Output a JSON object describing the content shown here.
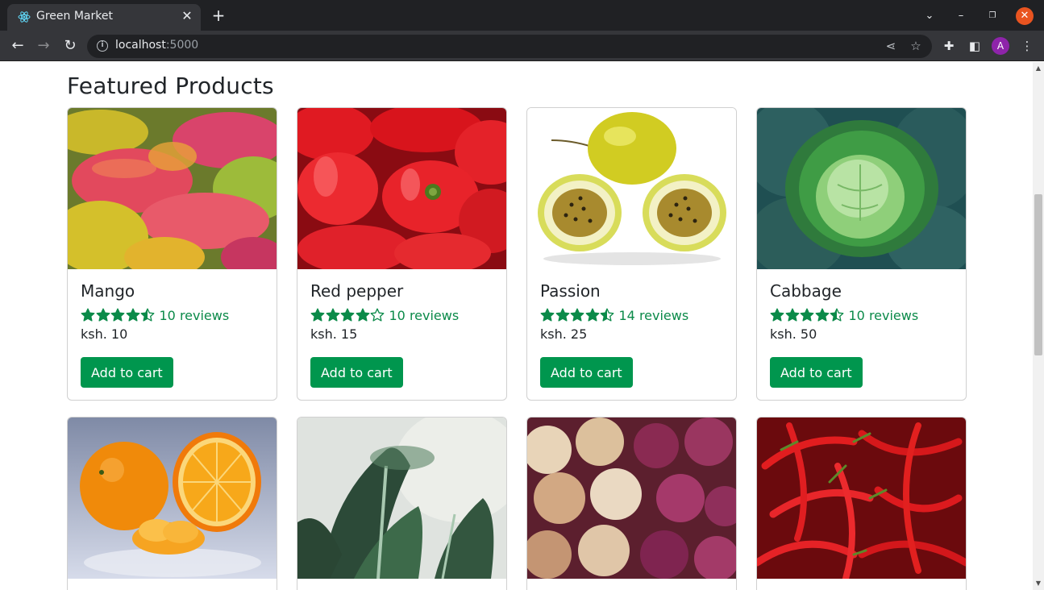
{
  "browser": {
    "tab_title": "Green Market",
    "url_host": "localhost",
    "url_port": ":5000",
    "profile_initial": "A"
  },
  "page": {
    "section_title": "Featured Products",
    "currency_prefix": "ksh. "
  },
  "products": [
    {
      "name": "Mango",
      "rating": 4.5,
      "reviews": "10 reviews",
      "price": "ksh. 10",
      "button": "Add to cart",
      "image": "mango"
    },
    {
      "name": "Red pepper",
      "rating": 4,
      "reviews": "10 reviews",
      "price": "ksh. 15",
      "button": "Add to cart",
      "image": "red-pepper"
    },
    {
      "name": "Passion",
      "rating": 4.5,
      "reviews": "14 reviews",
      "price": "ksh. 25",
      "button": "Add to cart",
      "image": "passion"
    },
    {
      "name": "Cabbage",
      "rating": 4.5,
      "reviews": "10 reviews",
      "price": "ksh. 50",
      "button": "Add to cart",
      "image": "cabbage"
    },
    {
      "name": "",
      "image": "orange"
    },
    {
      "name": "",
      "image": "kale"
    },
    {
      "name": "",
      "image": "onions"
    },
    {
      "name": "",
      "image": "chili"
    }
  ],
  "colors": {
    "accent": "#00964e",
    "star": "#0b8a49",
    "chrome_dark": "#202124",
    "chrome_mid": "#35363a"
  }
}
